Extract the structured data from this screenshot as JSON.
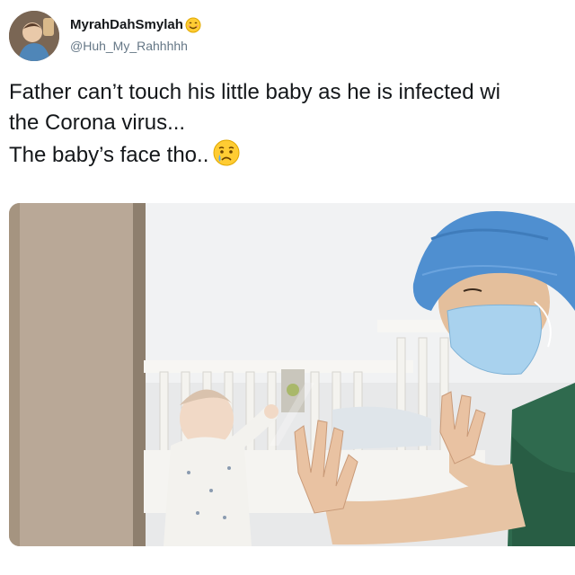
{
  "tweet": {
    "display_name": "MyrahDahSmylah",
    "name_emoji": "smiling-face-icon",
    "handle": "@Huh_My_Rahhhhh",
    "text_line_1": "Father can’t touch his little baby as he is infected wi",
    "text_line_2": "the Corona virus...",
    "text_line_3": "The baby’s face tho..",
    "text_emoji": "crying-face-icon"
  },
  "media": {
    "kind": "photo",
    "icon": "photo-icon"
  },
  "colors": {
    "text": "#14171a",
    "secondary": "#657786",
    "scrub_cap": "#4f8fd0",
    "mask": "#a9d2ee",
    "scrubs": "#2f6a4e"
  }
}
